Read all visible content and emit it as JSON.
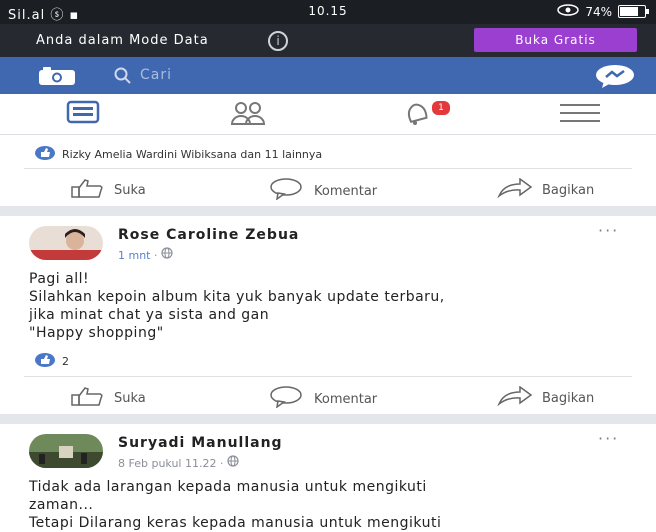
{
  "status_bar": {
    "left": "Sil.al ⓢ ▪",
    "time": "10.15",
    "right": "74%"
  },
  "data_mode": {
    "text": "Anda dalam Mode Data",
    "button": "Buka Gratis"
  },
  "topbar": {
    "search_placeholder": "Cari"
  },
  "nav": {
    "notification_count": "1"
  },
  "post1": {
    "likes_text": "Rizky Amelia Wardini Wibiksana dan 11 lainnya",
    "actions": {
      "like": "Suka",
      "comment": "Komentar",
      "share": "Bagikan"
    }
  },
  "post2": {
    "author": "Rose Caroline Zebua",
    "time": "1 mnt",
    "body": "Pagi all!\nSilahkan kepoin album kita yuk banyak update terbaru,\njika minat chat ya sista and gan\n\"Happy shopping\"",
    "reaction_count": "2",
    "actions": {
      "like": "Suka",
      "comment": "Komentar",
      "share": "Bagikan"
    }
  },
  "post3": {
    "author": "Suryadi Manullang",
    "time": "8 Feb pukul 11.22",
    "body": "Tidak ada larangan kepada manusia untuk mengikuti\nzaman...\nTetapi Dilarang keras kepada manusia untuk mengikuti"
  },
  "colors": {
    "fb_blue": "#4068b0",
    "badge_red": "#e4393c",
    "data_button": "#9a3fcf"
  }
}
